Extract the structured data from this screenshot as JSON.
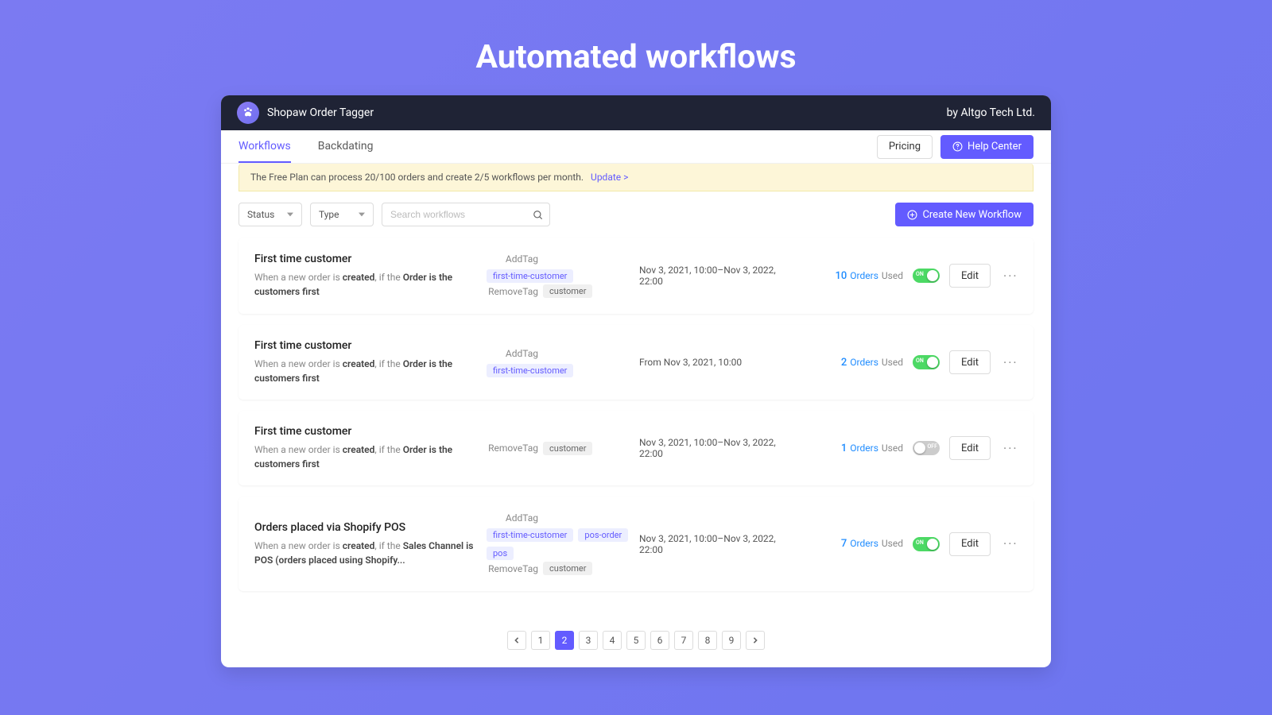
{
  "hero": {
    "title": "Automated workflows"
  },
  "header": {
    "app_name": "Shopaw Order Tagger",
    "byline": "by Altgo Tech Ltd."
  },
  "nav": {
    "tabs": [
      "Workflows",
      "Backdating"
    ],
    "active_index": 0,
    "pricing_label": "Pricing",
    "help_label": "Help Center"
  },
  "notice": {
    "text": "The Free Plan can process 20/100 orders and create 2/5 workflows per month.",
    "link": "Update >"
  },
  "toolbar": {
    "status_label": "Status",
    "type_label": "Type",
    "search_placeholder": "Search workflows",
    "create_label": "Create New Workflow"
  },
  "workflows": [
    {
      "title": "First time customer",
      "desc_pre": "When a new order is ",
      "desc_bold1": "created",
      "desc_mid": ", if the ",
      "desc_bold2": "Order is the customers first",
      "add_tags": [
        "first-time-customer"
      ],
      "add_tag_styles": [
        "purple"
      ],
      "remove_tags": [
        "customer"
      ],
      "date": "Nov 3, 2021, 10:00–Nov 3, 2022, 22:00",
      "count": "10",
      "orders_word": "Orders",
      "used_word": "Used",
      "on": true
    },
    {
      "title": "First time customer",
      "desc_pre": "When a new order is ",
      "desc_bold1": "created",
      "desc_mid": ", if the ",
      "desc_bold2": "Order is the customers first",
      "add_tags": [
        "first-time-customer"
      ],
      "add_tag_styles": [
        "purple"
      ],
      "remove_tags": [],
      "date": "From Nov 3, 2021, 10:00",
      "count": "2",
      "orders_word": "Orders",
      "used_word": "Used",
      "on": true
    },
    {
      "title": "First time customer",
      "desc_pre": "When a new order is ",
      "desc_bold1": "created",
      "desc_mid": ", if the ",
      "desc_bold2": "Order is the customers first",
      "add_tags": [],
      "add_tag_styles": [],
      "remove_tags": [
        "customer"
      ],
      "date": "Nov 3, 2021, 10:00–Nov 3, 2022, 22:00",
      "count": "1",
      "orders_word": "Orders",
      "used_word": "Used",
      "on": false
    },
    {
      "title": "Orders placed via Shopify POS",
      "desc_pre": "When a new order is ",
      "desc_bold1": "created",
      "desc_mid": ", if the ",
      "desc_bold2": "Sales Channel is POS (orders placed using Shopify...",
      "add_tags": [
        "first-time-customer",
        "pos-order",
        "pos"
      ],
      "add_tag_styles": [
        "purple",
        "purple",
        "purple"
      ],
      "remove_tags": [
        "customer"
      ],
      "date": "Nov 3, 2021, 10:00–Nov 3, 2022, 22:00",
      "count": "7",
      "orders_word": "Orders",
      "used_word": "Used",
      "on": true
    }
  ],
  "tag_labels": {
    "add": "AddTag",
    "remove": "RemoveTag"
  },
  "actions": {
    "edit": "Edit"
  },
  "pagination": {
    "pages": [
      "1",
      "2",
      "3",
      "4",
      "5",
      "6",
      "7",
      "8",
      "9"
    ],
    "active_index": 1
  }
}
